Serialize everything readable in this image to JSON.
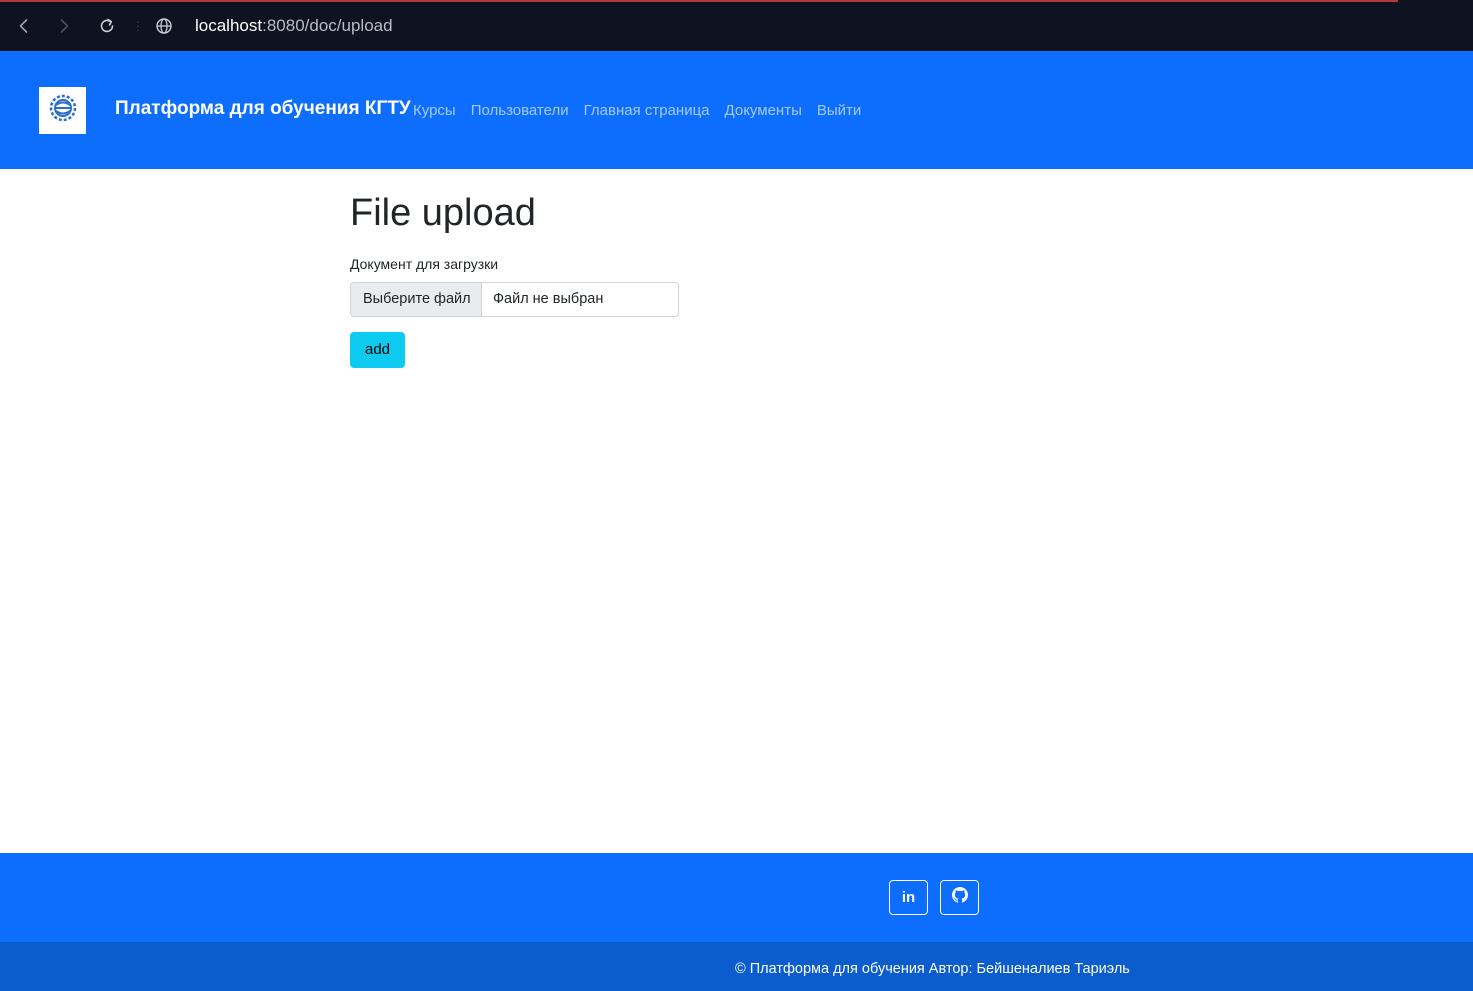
{
  "browser": {
    "url_host": "localhost",
    "url_rest": ":8080/doc/upload"
  },
  "navbar": {
    "brand": "Платформа для обучения КГТУ",
    "links": [
      "Курсы",
      "Пользователи",
      "Главная страница",
      "Документы",
      "Выйти"
    ]
  },
  "main": {
    "title": "File upload",
    "file_label": "Документ для загрузки",
    "file_button": "Выберите файл",
    "file_status": "Файл не выбран",
    "submit_label": "add"
  },
  "footer": {
    "linkedin_label": "in",
    "copyright": "© Платформа для обучения Автор: Бейшеналиев Тариэль"
  },
  "colors": {
    "primary": "#0d6efd",
    "footer_bottom": "#0b5ccc",
    "info_button": "#0dcaf0",
    "chrome_bg": "#0f1220"
  },
  "icons": [
    "back-arrow-icon",
    "forward-arrow-icon",
    "reload-icon",
    "globe-icon",
    "logo-gear-icon",
    "linkedin-icon",
    "github-icon"
  ]
}
